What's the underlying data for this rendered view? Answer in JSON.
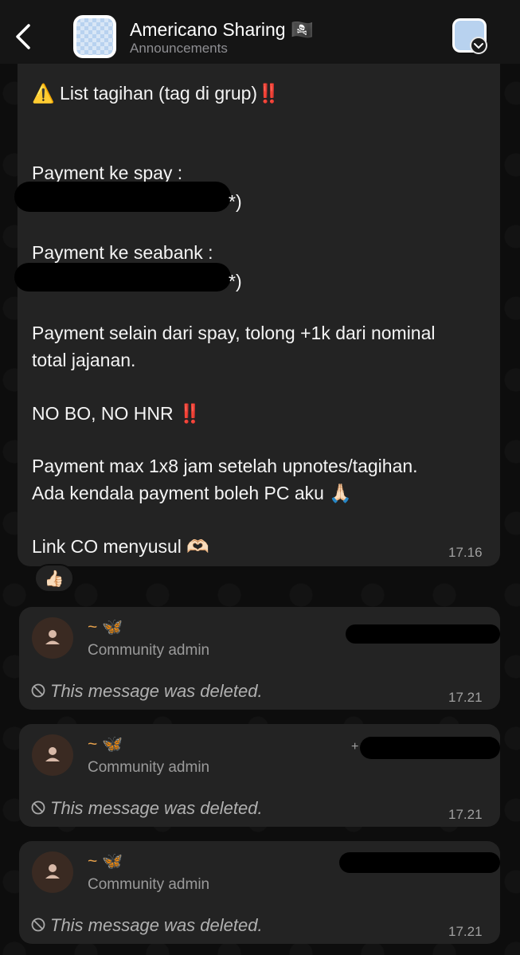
{
  "header": {
    "title": "Americano Sharing",
    "title_emoji": "🏴‍☠️",
    "subtitle": "Announcements",
    "back_icon": "chevron-left-icon"
  },
  "message": {
    "heading_emoji": "⚠️",
    "heading": "List tagihan (tag di grup)",
    "heading_marks": "‼️",
    "spay_label": "Payment ke spay :",
    "spay_suffix": "*)",
    "seabank_label": "Payment ke seabank :",
    "seabank_suffix": "*)",
    "note_line1": "Payment selain dari spay, tolong +1k dari nominal",
    "note_line2": "total jajanan.",
    "no_bo": "NO BO, NO HNR",
    "no_bo_marks": "‼️",
    "deadline_line1": "Payment max 1x8 jam setelah upnotes/tagihan.",
    "deadline_line2": "Ada kendala payment boleh PC aku",
    "deadline_emoji": "🙏🏻",
    "link_line": "Link CO menyusul",
    "link_emoji": "🫶🏻",
    "time": "17.16",
    "reaction": "👍🏻"
  },
  "deleted_messages": [
    {
      "name": "~ 🦋",
      "role": "Community admin",
      "text": "This message was deleted.",
      "time": "17.21",
      "phone_prefix": ""
    },
    {
      "name": "~ 🦋",
      "role": "Community admin",
      "text": "This message was deleted.",
      "time": "17.21",
      "phone_prefix": "+"
    },
    {
      "name": "~ 🦋",
      "role": "Community admin",
      "text": "This message was deleted.",
      "time": "17.21",
      "phone_prefix": ""
    }
  ],
  "colors": {
    "background": "#0d0d0d",
    "bubble": "#232323",
    "admin_name": "#e8a24c",
    "warning": "#f5c518",
    "exclamation": "#e3262b"
  }
}
